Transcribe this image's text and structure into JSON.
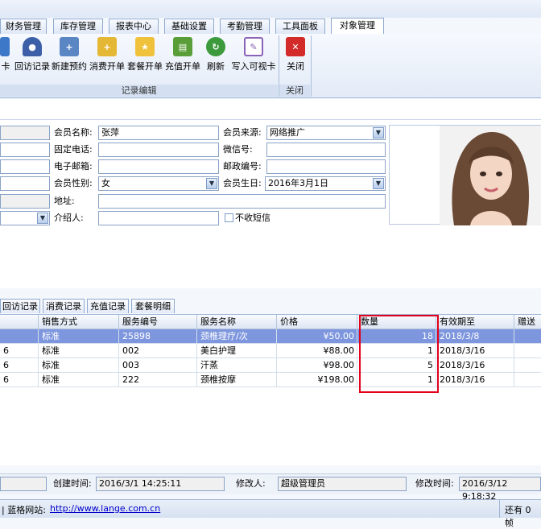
{
  "menu_tabs": [
    "财务管理",
    "库存管理",
    "报表中心",
    "基础设置",
    "考勤管理",
    "工具面板",
    "对象管理"
  ],
  "ribbon": {
    "buttons": [
      "卡",
      "回访记录",
      "新建预约",
      "消费开单",
      "套餐开单",
      "充值开单",
      "刷新",
      "写入可视卡"
    ],
    "close_label": "关闭",
    "group_edit_label": "记录编辑",
    "group_close_label": "关闭"
  },
  "form": {
    "member_name_label": "会员名称:",
    "member_name_value": "张萍",
    "phone_label": "固定电话:",
    "email_label": "电子邮箱:",
    "gender_label": "会员性别:",
    "gender_value": "女",
    "address_label": "地址:",
    "referrer_label": "介绍人:",
    "source_label": "会员来源:",
    "source_value": "网络推广",
    "wechat_label": "微信号:",
    "postcode_label": "邮政编号:",
    "birthday_label": "会员生日:",
    "birthday_value": "2016年3月1日",
    "no_sms_label": "不收短信"
  },
  "record_tabs": [
    "回访记录",
    "消费记录",
    "充值记录",
    "套餐明细"
  ],
  "grid": {
    "columns": [
      "销售方式",
      "服务编号",
      "服务名称",
      "价格",
      "数量",
      "有效期至",
      "赠送"
    ],
    "rows": [
      {
        "prefix": "",
        "sale": "标准",
        "code": "25898",
        "name": "颈椎理疗/次",
        "price": "¥50.00",
        "qty": "18",
        "expiry": "2018/3/8"
      },
      {
        "prefix": "6",
        "sale": "标准",
        "code": "002",
        "name": "美白护理",
        "price": "¥88.00",
        "qty": "1",
        "expiry": "2018/3/16"
      },
      {
        "prefix": "6",
        "sale": "标准",
        "code": "003",
        "name": "汗蒸",
        "price": "¥98.00",
        "qty": "5",
        "expiry": "2018/3/16"
      },
      {
        "prefix": "6",
        "sale": "标准",
        "code": "222",
        "name": "颈椎按摩",
        "price": "¥198.00",
        "qty": "1",
        "expiry": "2018/3/16"
      }
    ]
  },
  "footer": {
    "created_label": "创建时间:",
    "created_value": "2016/3/1 14:25:11",
    "modifier_label": "修改人:",
    "modifier_value": "超级管理员",
    "modified_label": "修改时间:",
    "modified_value": "2016/3/12 9:18:32"
  },
  "status": {
    "site_label": "| 蓝格网站:",
    "site_url": "http://www.lange.com.cn",
    "right_text": "还有 0 帧"
  }
}
